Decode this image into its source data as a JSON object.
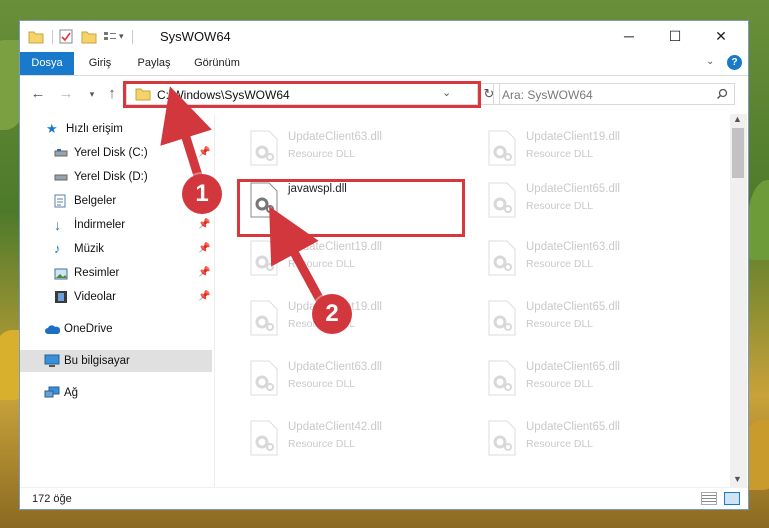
{
  "window": {
    "title": "SysWOW64"
  },
  "controls": {
    "minimize": "─",
    "maximize": "☐",
    "close": "✕",
    "help": "?"
  },
  "ribbon": {
    "tabs": [
      "Dosya",
      "Giriş",
      "Paylaş",
      "Görünüm"
    ],
    "active": "Dosya"
  },
  "address": {
    "path": "C:\\Windows\\SysWOW64",
    "refresh_symbol": "↻"
  },
  "search": {
    "placeholder": "Ara: SysWOW64"
  },
  "nav": {
    "items": [
      {
        "label": "Hızlı erişim",
        "icon": "star-icon",
        "pinned": false
      },
      {
        "label": "Yerel Disk (C:)",
        "icon": "drive-icon",
        "pinned": true
      },
      {
        "label": "Yerel Disk (D:)",
        "icon": "drive-icon",
        "pinned": false
      },
      {
        "label": "Belgeler",
        "icon": "documents-icon",
        "pinned": true
      },
      {
        "label": "İndirmeler",
        "icon": "download-icon",
        "pinned": true
      },
      {
        "label": "Müzik",
        "icon": "music-icon",
        "pinned": true
      },
      {
        "label": "Resimler",
        "icon": "pictures-icon",
        "pinned": true
      },
      {
        "label": "Videolar",
        "icon": "video-icon",
        "pinned": true
      },
      {
        "label": "OneDrive",
        "icon": "cloud-icon",
        "pinned": false
      },
      {
        "label": "Bu bilgisayar",
        "icon": "computer-icon",
        "pinned": false,
        "selected": true
      },
      {
        "label": "Ağ",
        "icon": "network-icon",
        "pinned": false
      }
    ]
  },
  "files": {
    "left": [
      {
        "name": "UpdateClient63.dll",
        "type": "Resource DLL",
        "highlighted": false
      },
      {
        "name": "javawspl.dll",
        "type": "",
        "highlighted": true
      },
      {
        "name": "UpdateClient19.dll",
        "type": "Resource DLL",
        "highlighted": false
      },
      {
        "name": "UpdateClient19.dll",
        "type": "Resource DLL",
        "highlighted": false
      },
      {
        "name": "UpdateClient63.dll",
        "type": "Resource DLL",
        "highlighted": false
      },
      {
        "name": "UpdateClient42.dll",
        "type": "Resource DLL",
        "highlighted": false
      }
    ],
    "right": [
      {
        "name": "UpdateClient19.dll",
        "type": "Resource DLL"
      },
      {
        "name": "UpdateClient65.dll",
        "type": "Resource DLL"
      },
      {
        "name": "UpdateClient63.dll",
        "type": "Resource DLL"
      },
      {
        "name": "UpdateClient65.dll",
        "type": "Resource DLL"
      },
      {
        "name": "UpdateClient65.dll",
        "type": "Resource DLL"
      },
      {
        "name": "UpdateClient65.dll",
        "type": "Resource DLL"
      }
    ]
  },
  "status": {
    "count_text": "172 öğe"
  },
  "annotations": {
    "step1": "1",
    "step2": "2",
    "color": "#d9363e"
  },
  "colors": {
    "accent": "#1979ca",
    "annotation": "#d2373e"
  }
}
